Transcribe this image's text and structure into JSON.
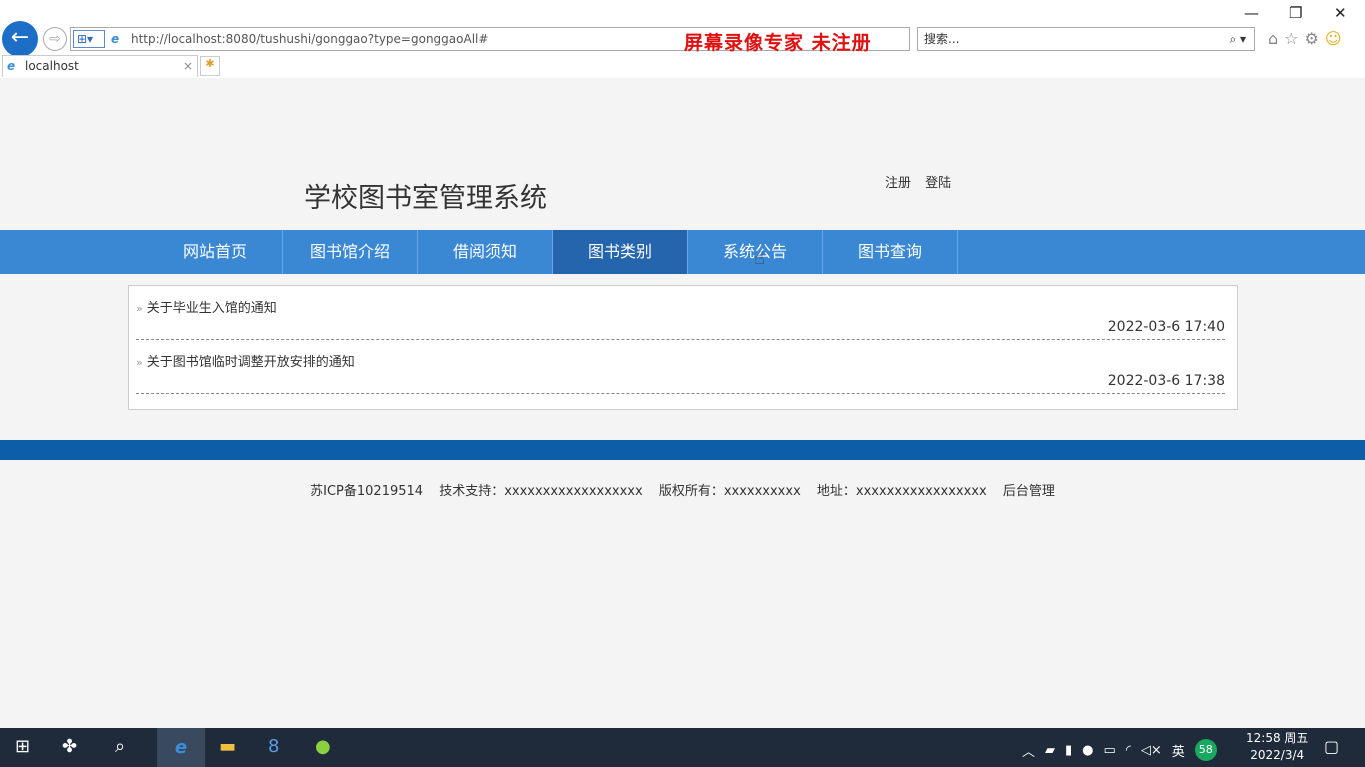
{
  "browser": {
    "url": "http://localhost:8080/tushushi/gonggao?type=gonggaoAll#",
    "watermark": "屏幕录像专家  未注册",
    "search_placeholder": "搜索...",
    "tab_title": "localhost"
  },
  "site": {
    "title": "学校图书室管理系统",
    "register": "注册",
    "login": "登陆"
  },
  "nav": [
    "网站首页",
    "图书馆介绍",
    "借阅须知",
    "图书类别",
    "系统公告",
    "图书查询"
  ],
  "notices": [
    {
      "title": "关于毕业生入馆的通知",
      "date": "2022-03-6 17:40"
    },
    {
      "title": "关于图书馆临时调整开放安排的通知",
      "date": "2022-03-6 17:38"
    }
  ],
  "bullet": "»",
  "footer": {
    "icp": "苏ICP备10219514",
    "support": "技术支持：xxxxxxxxxxxxxxxxxx",
    "copyright": "版权所有：xxxxxxxxxx",
    "address": "地址：xxxxxxxxxxxxxxxxx",
    "admin": "后台管理"
  },
  "taskbar": {
    "ime": "英",
    "badge": "58",
    "time": "12:58 周五",
    "date": "2022/3/4"
  }
}
